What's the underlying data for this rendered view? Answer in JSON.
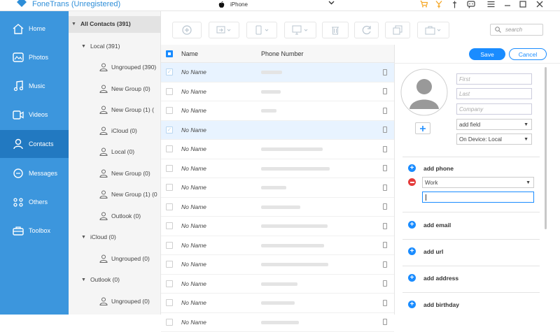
{
  "app": {
    "title": "FoneTrans (Unregistered)"
  },
  "device": {
    "name": "iPhone"
  },
  "sidebar": {
    "items": [
      {
        "label": "Home",
        "icon": "home-icon"
      },
      {
        "label": "Photos",
        "icon": "photos-icon"
      },
      {
        "label": "Music",
        "icon": "music-icon"
      },
      {
        "label": "Videos",
        "icon": "videos-icon"
      },
      {
        "label": "Contacts",
        "icon": "contacts-icon",
        "active": true
      },
      {
        "label": "Messages",
        "icon": "messages-icon"
      },
      {
        "label": "Others",
        "icon": "others-icon"
      },
      {
        "label": "Toolbox",
        "icon": "toolbox-icon"
      }
    ]
  },
  "tree": {
    "all": "All Contacts (391)",
    "local": "Local (391)",
    "local_groups": [
      "Ungrouped (390)",
      "New Group (0)",
      "New Group (1) (",
      "iCloud (0)",
      "Local (0)",
      "New Group (0)",
      "New Group (1) (0",
      "Outlook (0)"
    ],
    "icloud": "iCloud (0)",
    "icloud_groups": [
      "Ungrouped (0)"
    ],
    "outlook": "Outlook (0)",
    "outlook_groups": [
      "Ungrouped (0)"
    ]
  },
  "toolbar": {
    "search_placeholder": "search"
  },
  "list": {
    "columns": {
      "name": "Name",
      "phone": "Phone Number"
    },
    "rows": [
      {
        "name": "No Name",
        "selected": true
      },
      {
        "name": "No Name",
        "selected": false
      },
      {
        "name": "No Name",
        "selected": false
      },
      {
        "name": "No Name",
        "selected": true
      },
      {
        "name": "No Name",
        "selected": false
      },
      {
        "name": "No Name",
        "selected": false
      },
      {
        "name": "No Name",
        "selected": false
      },
      {
        "name": "No Name",
        "selected": false
      },
      {
        "name": "No Name",
        "selected": false
      },
      {
        "name": "No Name",
        "selected": false
      },
      {
        "name": "No Name",
        "selected": false
      },
      {
        "name": "No Name",
        "selected": false
      },
      {
        "name": "No Name",
        "selected": false
      },
      {
        "name": "No Name",
        "selected": false
      }
    ]
  },
  "detail": {
    "save": "Save",
    "cancel": "Cancel",
    "first_placeholder": "First",
    "last_placeholder": "Last",
    "company_placeholder": "Company",
    "add_field": "add field",
    "on_device": "On Device: Local",
    "add_phone": "add phone",
    "phone_type": "Work",
    "add_email": "add email",
    "add_url": "add url",
    "add_address": "add address",
    "add_birthday": "add birthday"
  },
  "colors": {
    "accent": "#1a8cff",
    "sidebar": "#3c96dd",
    "sidebar_active": "#2279c1",
    "title": "#2e8ed8",
    "danger": "#e43b3b"
  }
}
